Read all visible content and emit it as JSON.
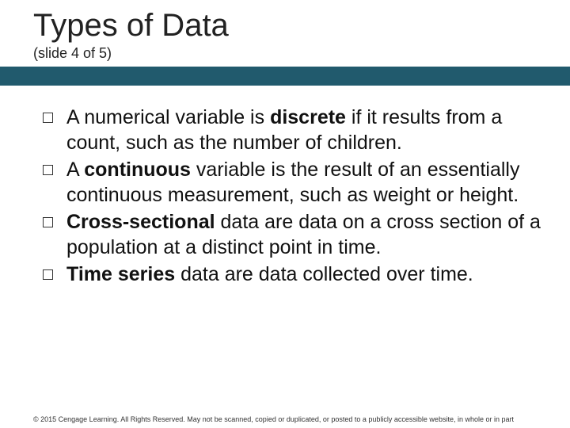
{
  "header": {
    "title": "Types of Data",
    "subtitle": "(slide 4 of 5)"
  },
  "bullets": [
    {
      "pre": "A numerical variable is ",
      "bold": "discrete",
      "post": " if it results from a count, such as the number of children."
    },
    {
      "pre": "A ",
      "bold": "continuous",
      "post": " variable is the result of an essentially continuous measurement, such as weight or height."
    },
    {
      "pre": "",
      "bold": "Cross-sectional",
      "post": " data are data on a cross section of a population at a distinct point in time."
    },
    {
      "pre": " ",
      "bold": "Time series",
      "post": " data are data collected over time."
    }
  ],
  "footer": {
    "text": "© 2015 Cengage Learning. All Rights Reserved. May not be scanned, copied or duplicated, or posted to a publicly accessible website, in whole or in part"
  }
}
